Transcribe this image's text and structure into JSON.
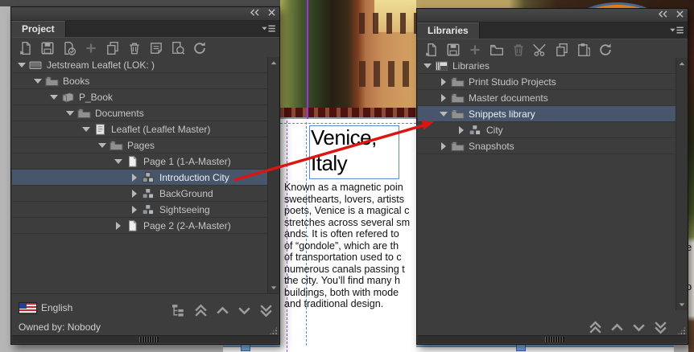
{
  "project_panel": {
    "tab": "Project",
    "toolbar_icons": [
      "new-document",
      "save",
      "save-status",
      "add",
      "duplicate",
      "delete",
      "notes",
      "preview-search",
      "refresh"
    ],
    "tree": [
      {
        "label": "Jetstream Leaflet (LOK: )"
      },
      {
        "label": "Books"
      },
      {
        "label": "P_Book"
      },
      {
        "label": "Documents"
      },
      {
        "label": "Leaflet (Leaflet Master)"
      },
      {
        "label": "Pages"
      },
      {
        "label": "Page 1 (1-A-Master)"
      },
      {
        "label": "Introduction City"
      },
      {
        "label": "BackGround"
      },
      {
        "label": "Sightseeing"
      },
      {
        "label": "Page 2 (2-A-Master)"
      }
    ],
    "selected_item": "Introduction City",
    "language_label": "English",
    "owner_label": "Owned by: Nobody"
  },
  "libraries_panel": {
    "tab": "Libraries",
    "toolbar_icons": [
      "new-document",
      "save",
      "add",
      "new-folder",
      "delete",
      "cut",
      "copy",
      "paste",
      "refresh"
    ],
    "tree": [
      {
        "label": "Libraries"
      },
      {
        "label": "Print Studio Projects"
      },
      {
        "label": "Master documents"
      },
      {
        "label": "Snippets library"
      },
      {
        "label": "City"
      },
      {
        "label": "Snapshots"
      }
    ],
    "selected_item": "Snippets library"
  },
  "document": {
    "headline_line1": "Venice,",
    "headline_line2": "Italy",
    "body_lines": [
      "Known as a magnetic poin",
      "sweethearts, lovers, artists",
      "poets, Venice is a magical c",
      "stretches across several sm",
      "ands. It is often refered to",
      "of “gondole”, which are th",
      "of transportation used to c",
      "numerous canals passing t",
      "the city. You’ll find many h",
      "buildings, both with mode",
      "and traditional design."
    ]
  },
  "background": {
    "right_edge_letters_1": "e",
    "right_edge_letters_2": "o"
  },
  "colors": {
    "selection": "#47566b",
    "annotation_arrow": "#dd1510",
    "guide_purple": "#9a36dd",
    "frame_blue": "#5b8ad0",
    "panel_bg": "#3d3d3d"
  }
}
